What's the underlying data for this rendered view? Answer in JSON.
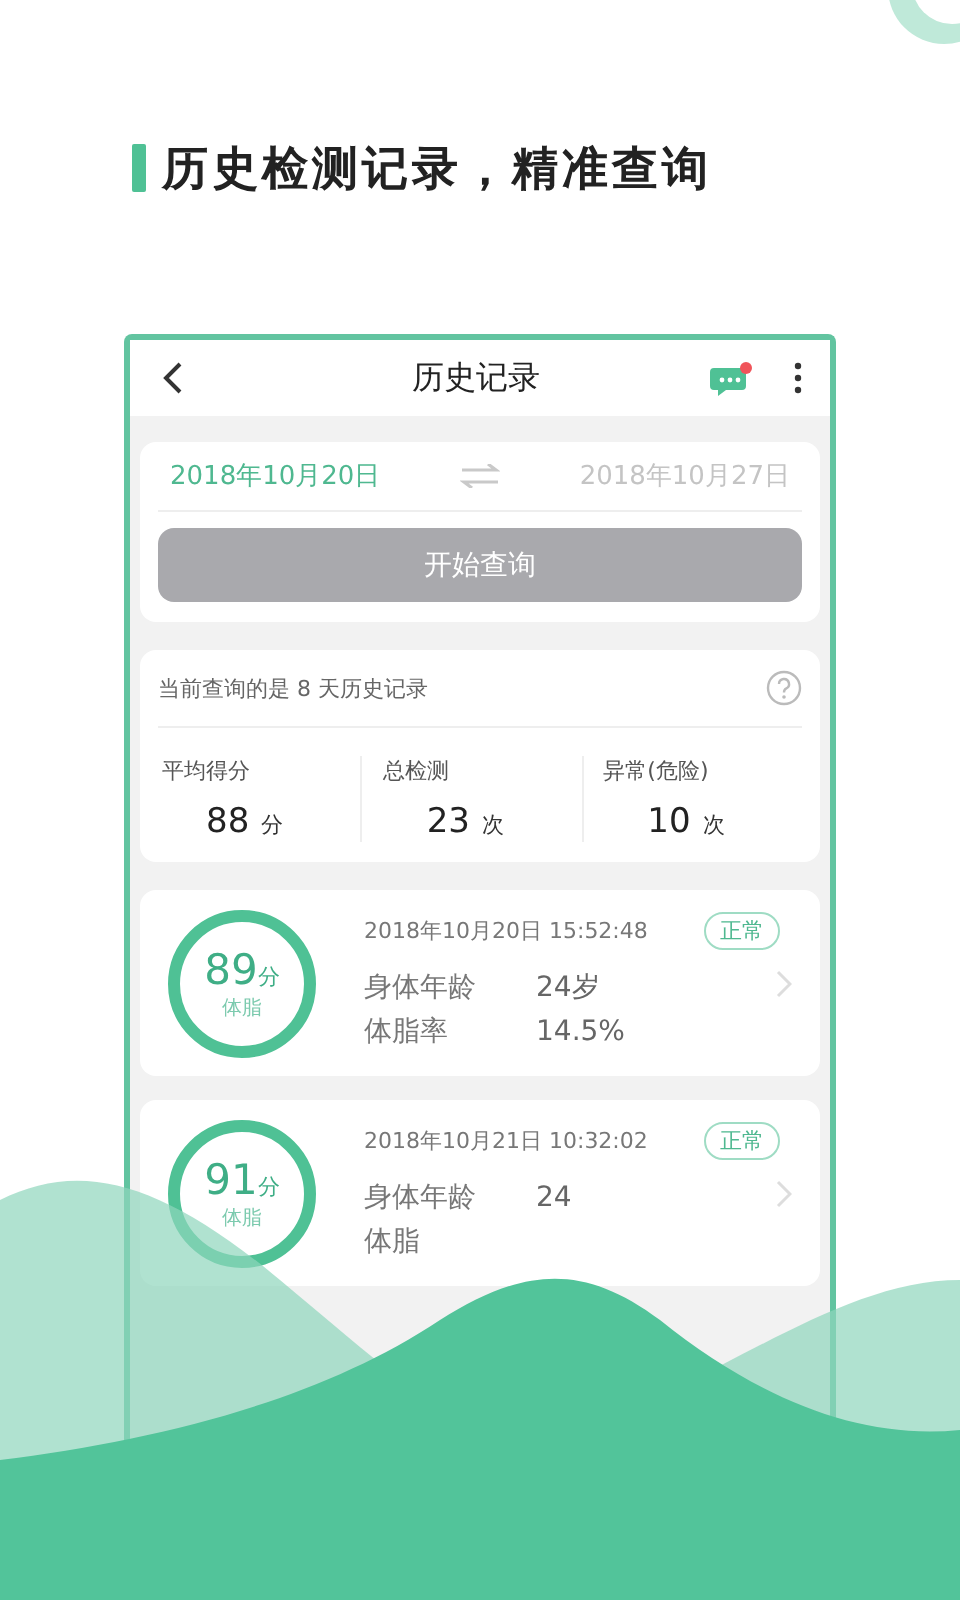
{
  "headline": "历史检测记录，精准查询",
  "app": {
    "title": "历史记录",
    "message_unread": true
  },
  "query": {
    "start_date": "2018年10月20日",
    "end_date": "2018年10月27日",
    "button": "开始查询"
  },
  "summary": {
    "note": "当前查询的是 8 天历史记录",
    "stats": [
      {
        "label": "平均得分",
        "value": "88",
        "unit": "分"
      },
      {
        "label": "总检测",
        "value": "23",
        "unit": "次"
      },
      {
        "label": "异常(危险)",
        "value": "10",
        "unit": "次"
      }
    ]
  },
  "records": [
    {
      "score": "89",
      "score_unit": "分",
      "score_label": "体脂",
      "time": "2018年10月20日 15:52:48",
      "status": "正常",
      "rows": [
        {
          "label": "身体年龄",
          "value": "24岁"
        },
        {
          "label": "体脂率",
          "value": "14.5%"
        }
      ]
    },
    {
      "score": "91",
      "score_unit": "分",
      "score_label": "体脂",
      "time": "2018年10月21日 10:32:02",
      "status": "正常",
      "rows": [
        {
          "label": "身体年龄",
          "value": "24"
        },
        {
          "label": "体脂"
        }
      ]
    }
  ]
}
